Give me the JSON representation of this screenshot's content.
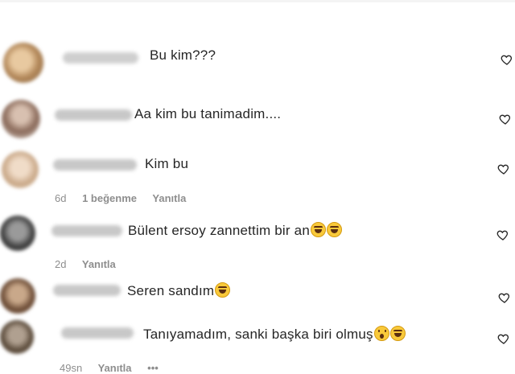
{
  "comments": [
    {
      "text": "Bu kim???",
      "emojis": []
    },
    {
      "text": "Aa kim bu tanimadim....",
      "emojis": []
    },
    {
      "text": "Kim bu",
      "emojis": [],
      "meta": {
        "time": "6d",
        "likes": "1 beğenme",
        "reply": "Yanıtla"
      }
    },
    {
      "text": "Bülent ersoy zannettim bir an",
      "emojis": [
        "laugh",
        "laugh"
      ],
      "meta": {
        "time": "2d",
        "reply": "Yanıtla"
      }
    },
    {
      "text": "Seren sandım",
      "emojis": [
        "laugh"
      ]
    },
    {
      "text": "Tanıyamadım, sanki başka biri olmuş",
      "emojis": [
        "wow",
        "laugh"
      ],
      "meta": {
        "time": "49sn",
        "reply": "Yanıtla",
        "more": "•••"
      }
    }
  ],
  "icons": {
    "like": "heart-outline-icon"
  }
}
